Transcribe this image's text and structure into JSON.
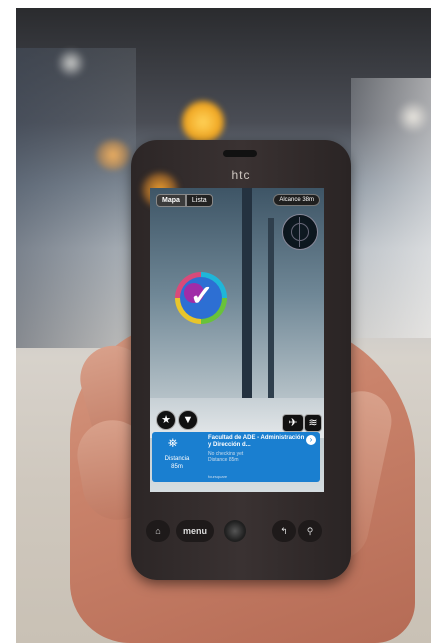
{
  "phone": {
    "brand": "htc",
    "buttons": {
      "home": "⌂",
      "menu": "menu",
      "back": "↰",
      "search": "⚲"
    }
  },
  "app": {
    "tabs": [
      {
        "label": "Mapa"
      },
      {
        "label": "Lista"
      }
    ],
    "range": "Alcance 38m",
    "poi_card": {
      "title": "Facultad de ADE - Administración y Dirección d...",
      "subtitle_1": "No checkins yet",
      "subtitle_2": "Distance 85m",
      "distance_label": "Distancia",
      "distance_value": "85m",
      "footer": "foursquare"
    }
  }
}
